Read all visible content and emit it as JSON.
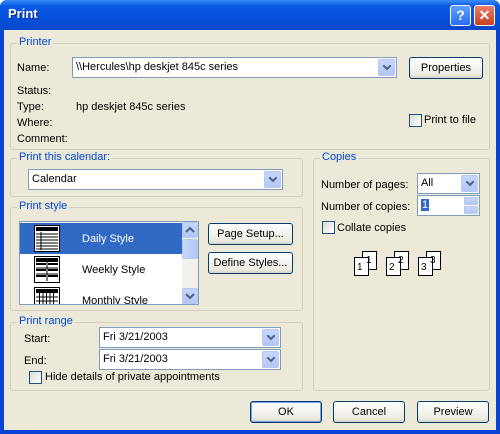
{
  "window": {
    "title": "Print",
    "help_label": "?",
    "close_label": "✕"
  },
  "printer": {
    "legend": "Printer",
    "name_label": "Name:",
    "name_value": "\\\\Hercules\\hp deskjet 845c series",
    "properties_label": "Properties",
    "status_label": "Status:",
    "type_label": "Type:",
    "type_value": "hp deskjet 845c series",
    "where_label": "Where:",
    "comment_label": "Comment:",
    "print_to_file_label": "Print to file",
    "print_to_file_checked": false
  },
  "calendar": {
    "legend": "Print this calendar:",
    "value": "Calendar"
  },
  "style": {
    "legend": "Print style",
    "items": [
      {
        "label": "Daily Style",
        "selected": true,
        "icon": "daily-style-icon"
      },
      {
        "label": "Weekly Style",
        "selected": false,
        "icon": "weekly-style-icon"
      },
      {
        "label": "Monthly Style",
        "selected": false,
        "icon": "monthly-style-icon"
      }
    ],
    "page_setup_label": "Page Setup...",
    "define_styles_label": "Define Styles..."
  },
  "range": {
    "legend": "Print range",
    "start_label": "Start:",
    "start_value": "Fri 3/21/2003",
    "end_label": "End:",
    "end_value": "Fri 3/21/2003",
    "hide_private_label": "Hide details of private appointments",
    "hide_private_checked": false
  },
  "copies": {
    "legend": "Copies",
    "pages_label": "Number of pages:",
    "pages_value": "All",
    "copies_label": "Number of copies:",
    "copies_value": "1",
    "collate_label": "Collate copies",
    "collate_checked": false,
    "collate_icon": "collate-copies-icon",
    "collate_numbers": [
      "1",
      "1",
      "2",
      "2",
      "3",
      "3"
    ]
  },
  "footer": {
    "ok_label": "OK",
    "cancel_label": "Cancel",
    "preview_label": "Preview"
  },
  "colors": {
    "titlebar": "#0a5ae6",
    "face": "#ece9d8",
    "legend": "#0046d5",
    "selection": "#316ac5"
  }
}
